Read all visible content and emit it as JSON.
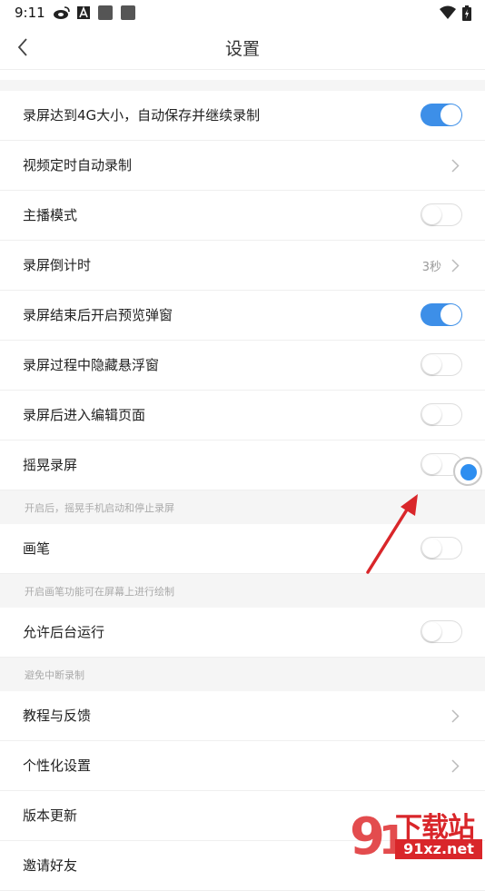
{
  "status_bar": {
    "time": "9:11"
  },
  "header": {
    "title": "设置"
  },
  "settings": [
    {
      "label": "录屏达到4G大小，自动保存并继续录制",
      "control": "toggle",
      "on": true
    },
    {
      "label": "视频定时自动录制",
      "control": "chevron"
    },
    {
      "label": "主播模式",
      "control": "toggle",
      "on": false
    },
    {
      "label": "录屏倒计时",
      "control": "chevron",
      "value": "3秒"
    },
    {
      "label": "录屏结束后开启预览弹窗",
      "control": "toggle",
      "on": true
    },
    {
      "label": "录屏过程中隐藏悬浮窗",
      "control": "toggle",
      "on": false
    },
    {
      "label": "录屏后进入编辑页面",
      "control": "toggle",
      "on": false
    },
    {
      "label": "摇晃录屏",
      "control": "toggle",
      "on": false
    },
    {
      "label": "画笔",
      "control": "toggle",
      "on": false
    },
    {
      "label": "允许后台运行",
      "control": "toggle",
      "on": false
    },
    {
      "label": "教程与反馈",
      "control": "chevron"
    },
    {
      "label": "个性化设置",
      "control": "chevron"
    },
    {
      "label": "版本更新",
      "control": "none"
    },
    {
      "label": "邀请好友",
      "control": "none"
    }
  ],
  "hints": [
    "开启后，摇晃手机启动和停止录屏",
    "开启画笔功能可在屏幕上进行绘制",
    "避免中断录制"
  ],
  "watermark": {
    "text": "下载站",
    "url": "91xz.net"
  },
  "colors": {
    "accent": "#3d8fe8",
    "annotation_arrow": "#d9262a"
  }
}
